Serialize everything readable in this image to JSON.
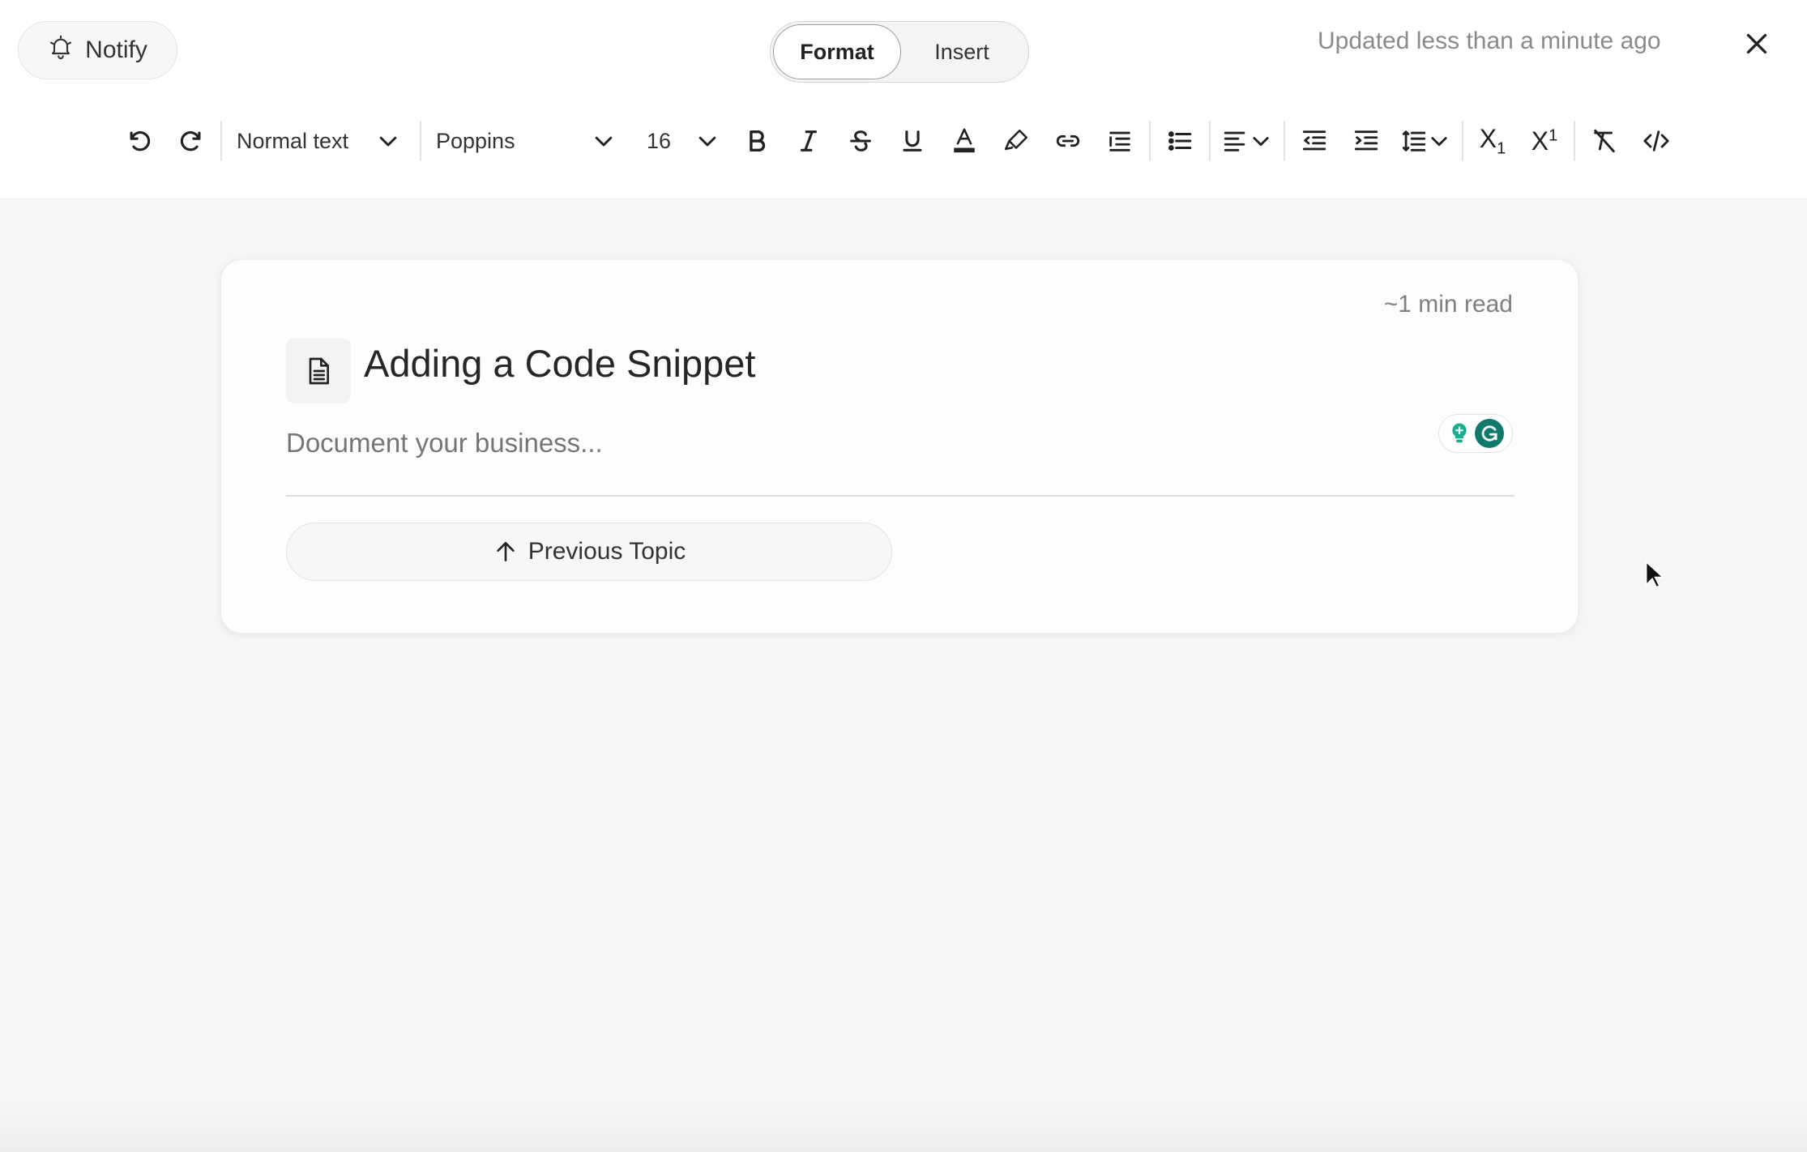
{
  "header": {
    "notify_label": "Notify",
    "mode_tabs": [
      {
        "label": "Format",
        "active": true
      },
      {
        "label": "Insert",
        "active": false
      }
    ],
    "updated_text": "Updated less than a minute ago"
  },
  "toolbar": {
    "block_style": "Normal text",
    "font_family": "Poppins",
    "font_size": "16",
    "subscript_label": "X",
    "subscript_sub": "1",
    "superscript_label": "X",
    "superscript_sup": "1",
    "icons": [
      "undo-icon",
      "redo-icon",
      "bold-icon",
      "italic-icon",
      "strikethrough-icon",
      "underline-icon",
      "text-color-icon",
      "highlight-icon",
      "link-icon",
      "ordered-list-icon",
      "bullet-list-icon",
      "align-icon",
      "outdent-icon",
      "indent-icon",
      "line-height-icon",
      "subscript-icon",
      "superscript-icon",
      "clear-format-icon",
      "code-icon"
    ],
    "text_color": "#222222"
  },
  "document": {
    "read_time": "~1 min read",
    "title": "Adding a Code Snippet",
    "body_placeholder": "Document your business...",
    "previous_topic_label": "Previous Topic"
  },
  "colors": {
    "background": "#f6f6f6",
    "card": "#fdfdfd",
    "grammarly_green": "#0f7a6b",
    "grammarly_bulb": "#17b08f"
  }
}
